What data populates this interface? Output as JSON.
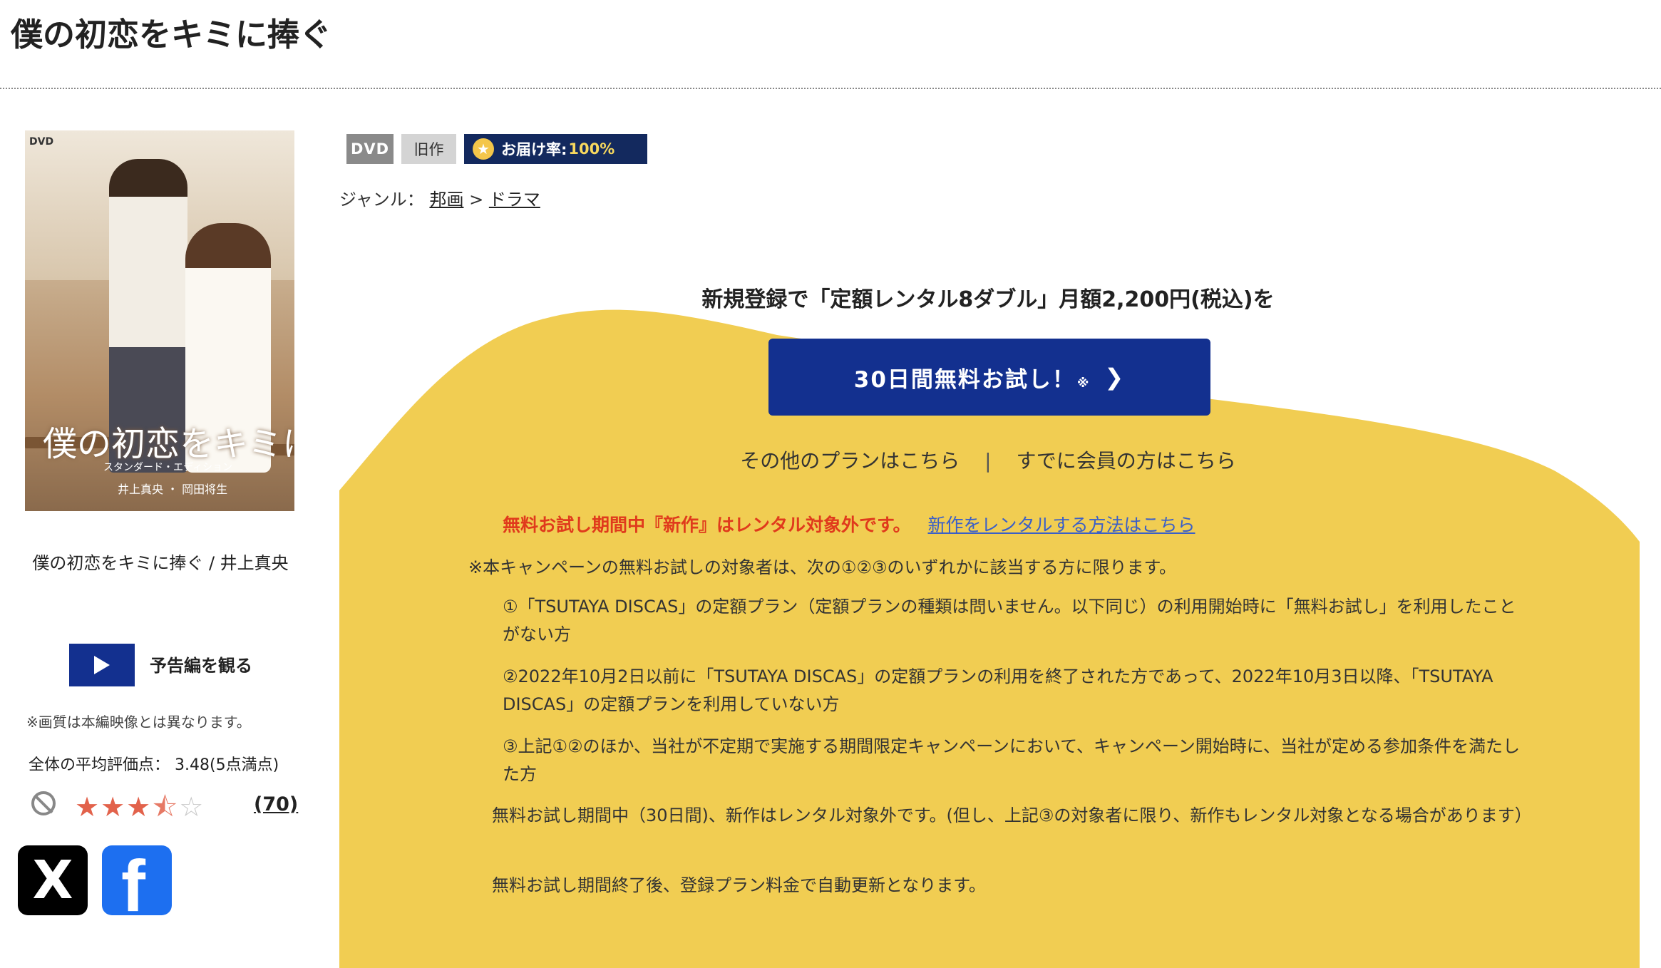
{
  "title": "僕の初恋をキミに捧ぐ",
  "cover": {
    "dvd_logo": "DVD",
    "title_text": "僕の初恋をキミに捧ぐ",
    "subtitle": "スタンダード・エディション",
    "cast": "井上真央 ・ 岡田将生"
  },
  "caption": "僕の初恋をキミに捧ぐ / 井上真央",
  "trailer_label": "予告編を観る",
  "note": "※画質は本編映像とは異なります。",
  "rating": {
    "label": "全体の平均評価点：",
    "score": "3.48(5点満点)",
    "value": 3.48,
    "max": 5,
    "count": "(70)"
  },
  "sns": {
    "x": "X",
    "facebook": "f"
  },
  "badges": {
    "dvd": "DVD",
    "old": "旧作",
    "rate_label": "お届け率:",
    "rate_value": "100%"
  },
  "genre": {
    "label": "ジャンル：",
    "item1": "邦画",
    "sep": ">",
    "item2": "ドラマ"
  },
  "campaign": {
    "headline": "新規登録で「定額レンタル8ダブル」月額2,200円(税込)を",
    "cta_text": "30日間無料お試し！",
    "cta_mark": "※",
    "cta_chevron": "❯",
    "link_other": "その他のプランはこちら",
    "link_sep": "|",
    "link_member": "すでに会員の方はこちら",
    "warning": "無料お試し期間中『新作』はレンタル対象外です。",
    "warning_link": "新作をレンタルする方法はこちら",
    "terms": "※本キャンペーンの無料お試しの対象者は、次の①②③のいずれかに該当する方に限ります。",
    "conditions": [
      "①「TSUTAYA DISCAS」の定額プラン（定額プランの種類は問いません。以下同じ）の利用開始時に「無料お試し」を利用したことがない方",
      "②2022年10月2日以前に「TSUTAYA DISCAS」の定額プランの利用を終了された方であって、2022年10月3日以降、「TSUTAYA DISCAS」の定額プランを利用していない方",
      "③上記①②のほか、当社が不定期で実施する期間限定キャンペーンにおいて、キャンペーン開始時に、当社が定める参加条件を満たした方"
    ],
    "para1": "無料お試し期間中（30日間)、新作はレンタル対象外です。(但し、上記③の対象者に限り、新作もレンタル対象となる場合があります）",
    "para2": "無料お試し期間終了後、登録プラン料金で自動更新となります。"
  },
  "colors": {
    "accent_blue": "#13308f",
    "yellow": "#f1cd52",
    "warning_red": "#e03a1c",
    "link_blue": "#3a5fc8"
  }
}
